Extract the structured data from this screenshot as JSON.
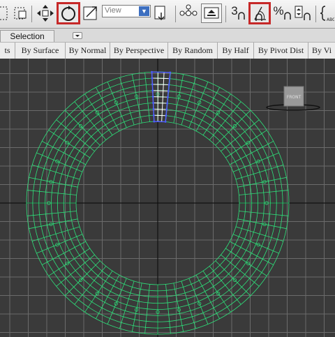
{
  "toolbar": {
    "buttons": [
      {
        "id": "select-region-icon"
      },
      {
        "id": "move-icon"
      },
      {
        "id": "rotate-icon",
        "highlighted": true
      },
      {
        "id": "scale-icon"
      },
      {
        "id": "pivot-icon"
      },
      {
        "id": "manipulate-icon"
      },
      {
        "id": "keyboard-shortcut-icon"
      },
      {
        "id": "snap-3d-icon",
        "label": "3"
      },
      {
        "id": "angle-snap-icon",
        "highlighted": true
      },
      {
        "id": "percent-snap-icon",
        "label": "%"
      },
      {
        "id": "spinner-snap-icon"
      },
      {
        "id": "named-selection-icon"
      }
    ],
    "reference_coord": "View",
    "highlight_color": "#c62828"
  },
  "ribbon": {
    "active_tab": "Selection"
  },
  "selection_bar": {
    "items": [
      "ts",
      "By Surface",
      "By Normal",
      "By Perspective",
      "By Random",
      "By Half",
      "By Pivot Dist",
      "By Vi"
    ]
  },
  "viewport": {
    "background": "#3a3a3a",
    "grid_color": "#6b6b6b",
    "axis_color": "#111111",
    "mesh_color": "#2ee07a",
    "selection_color": "#4d5cff",
    "viewcube_label": "FRONT"
  }
}
